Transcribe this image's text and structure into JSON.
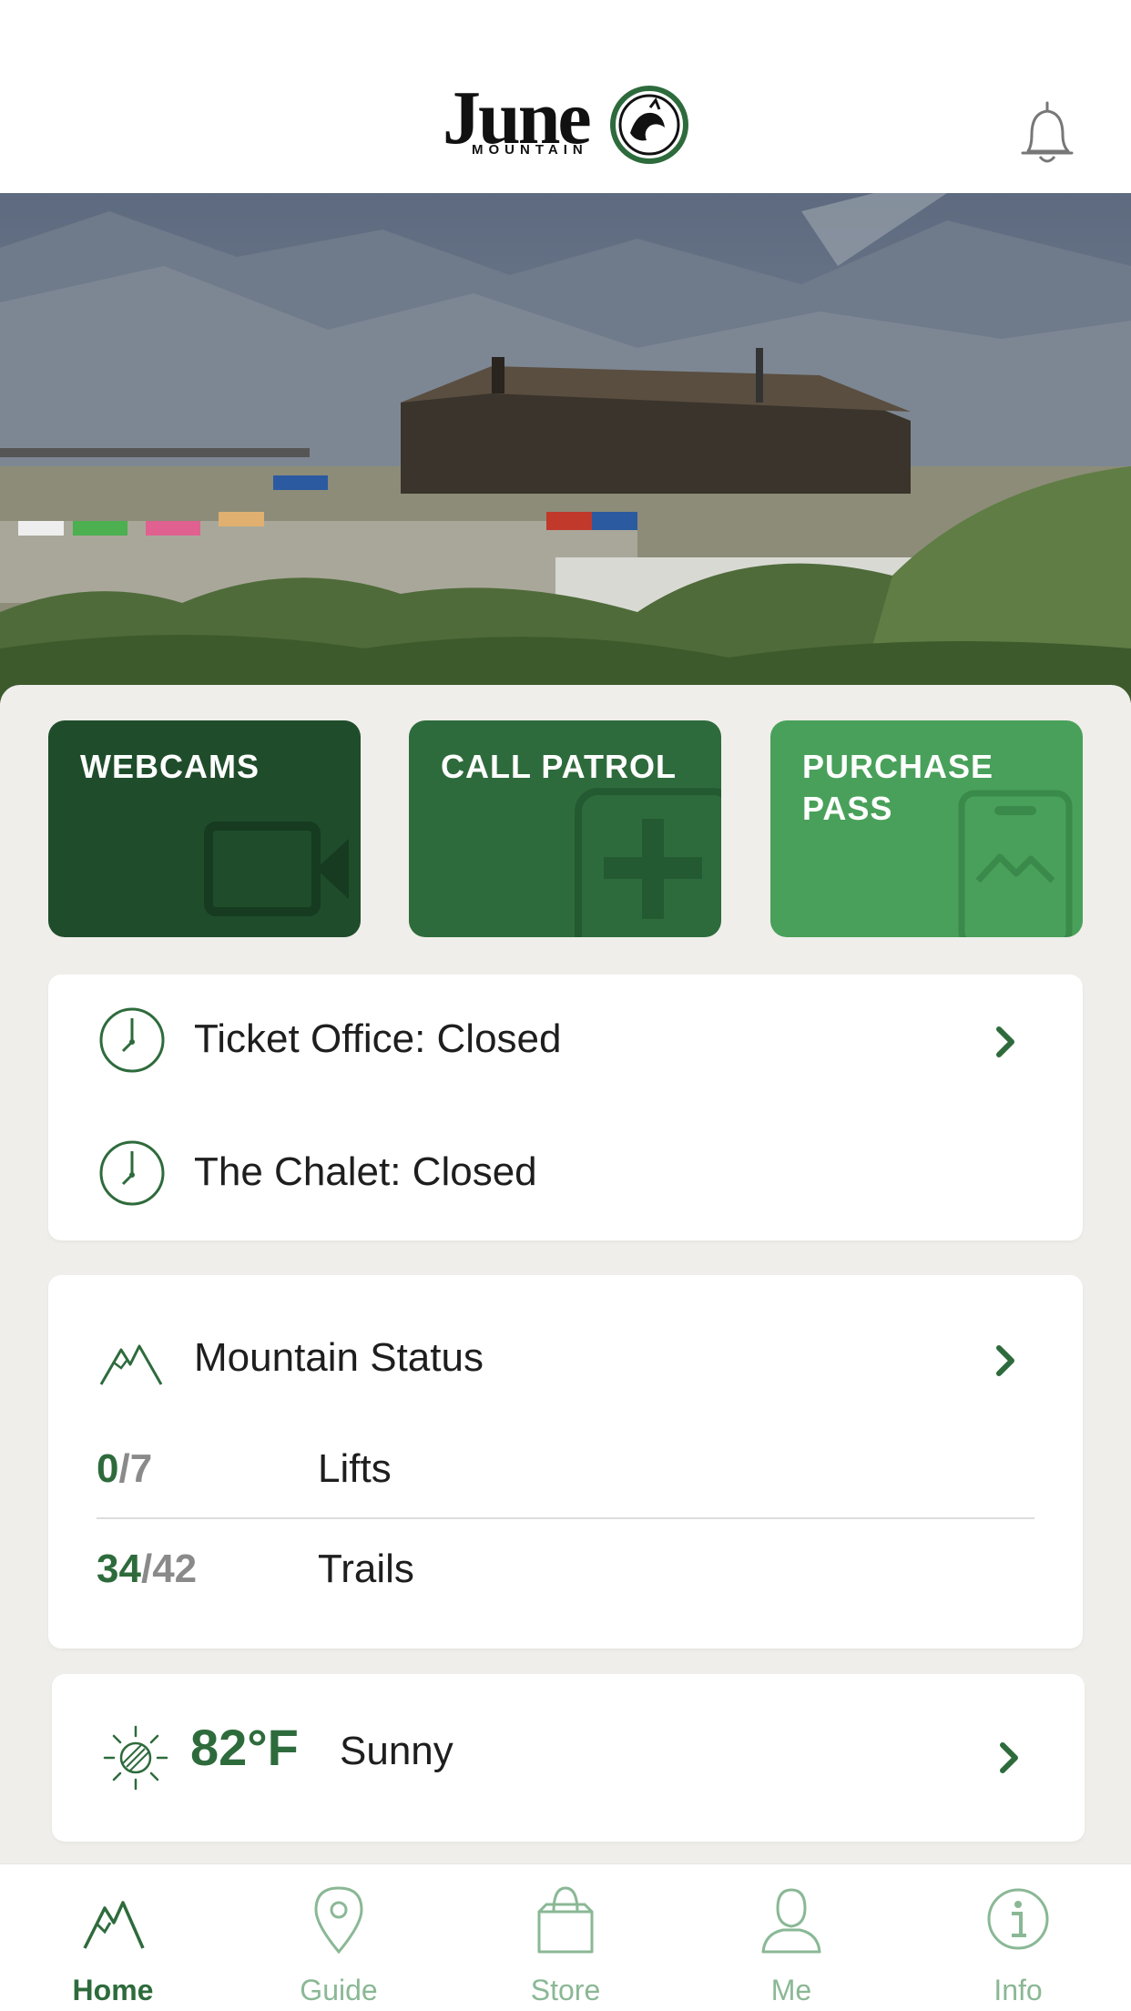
{
  "header": {
    "logo_word": "June",
    "logo_sub": "MOUNTAIN",
    "notification_icon": "bell-icon"
  },
  "hero": {
    "image": "summer-lodge-photo"
  },
  "tiles": [
    {
      "label": "WEBCAMS",
      "icon": "video-camera-icon",
      "color": "#1f4d2b"
    },
    {
      "label": "CALL PATROL",
      "icon": "medical-cross-icon",
      "color": "#2e6b3c"
    },
    {
      "label": "PURCHASE PASS",
      "icon": "phone-pass-icon",
      "color": "#49a05a"
    }
  ],
  "hours": [
    {
      "label": "Ticket Office: Closed",
      "icon": "clock-icon"
    },
    {
      "label": "The Chalet: Closed",
      "icon": "clock-icon"
    }
  ],
  "mountain_status": {
    "title": "Mountain Status",
    "icon": "mountain-icon",
    "lifts": {
      "open": "0",
      "separator": "/",
      "total": "7",
      "label": "Lifts"
    },
    "trails": {
      "open": "34",
      "separator": "/",
      "total": "42",
      "label": "Trails"
    }
  },
  "weather": {
    "temperature": "82°F",
    "condition": "Sunny",
    "icon": "sun-icon"
  },
  "tabbar": {
    "items": [
      {
        "label": "Home",
        "icon": "mountain-icon",
        "active": true
      },
      {
        "label": "Guide",
        "icon": "map-pin-icon",
        "active": false
      },
      {
        "label": "Store",
        "icon": "shopping-bag-icon",
        "active": false
      },
      {
        "label": "Me",
        "icon": "person-icon",
        "active": false
      },
      {
        "label": "Info",
        "icon": "info-icon",
        "active": false
      }
    ]
  },
  "colors": {
    "accent": "#2e6b3c",
    "dark_green": "#1f4d2b",
    "light_green": "#49a05a",
    "tab_inactive": "#8ab895",
    "background": "#efeeea"
  }
}
